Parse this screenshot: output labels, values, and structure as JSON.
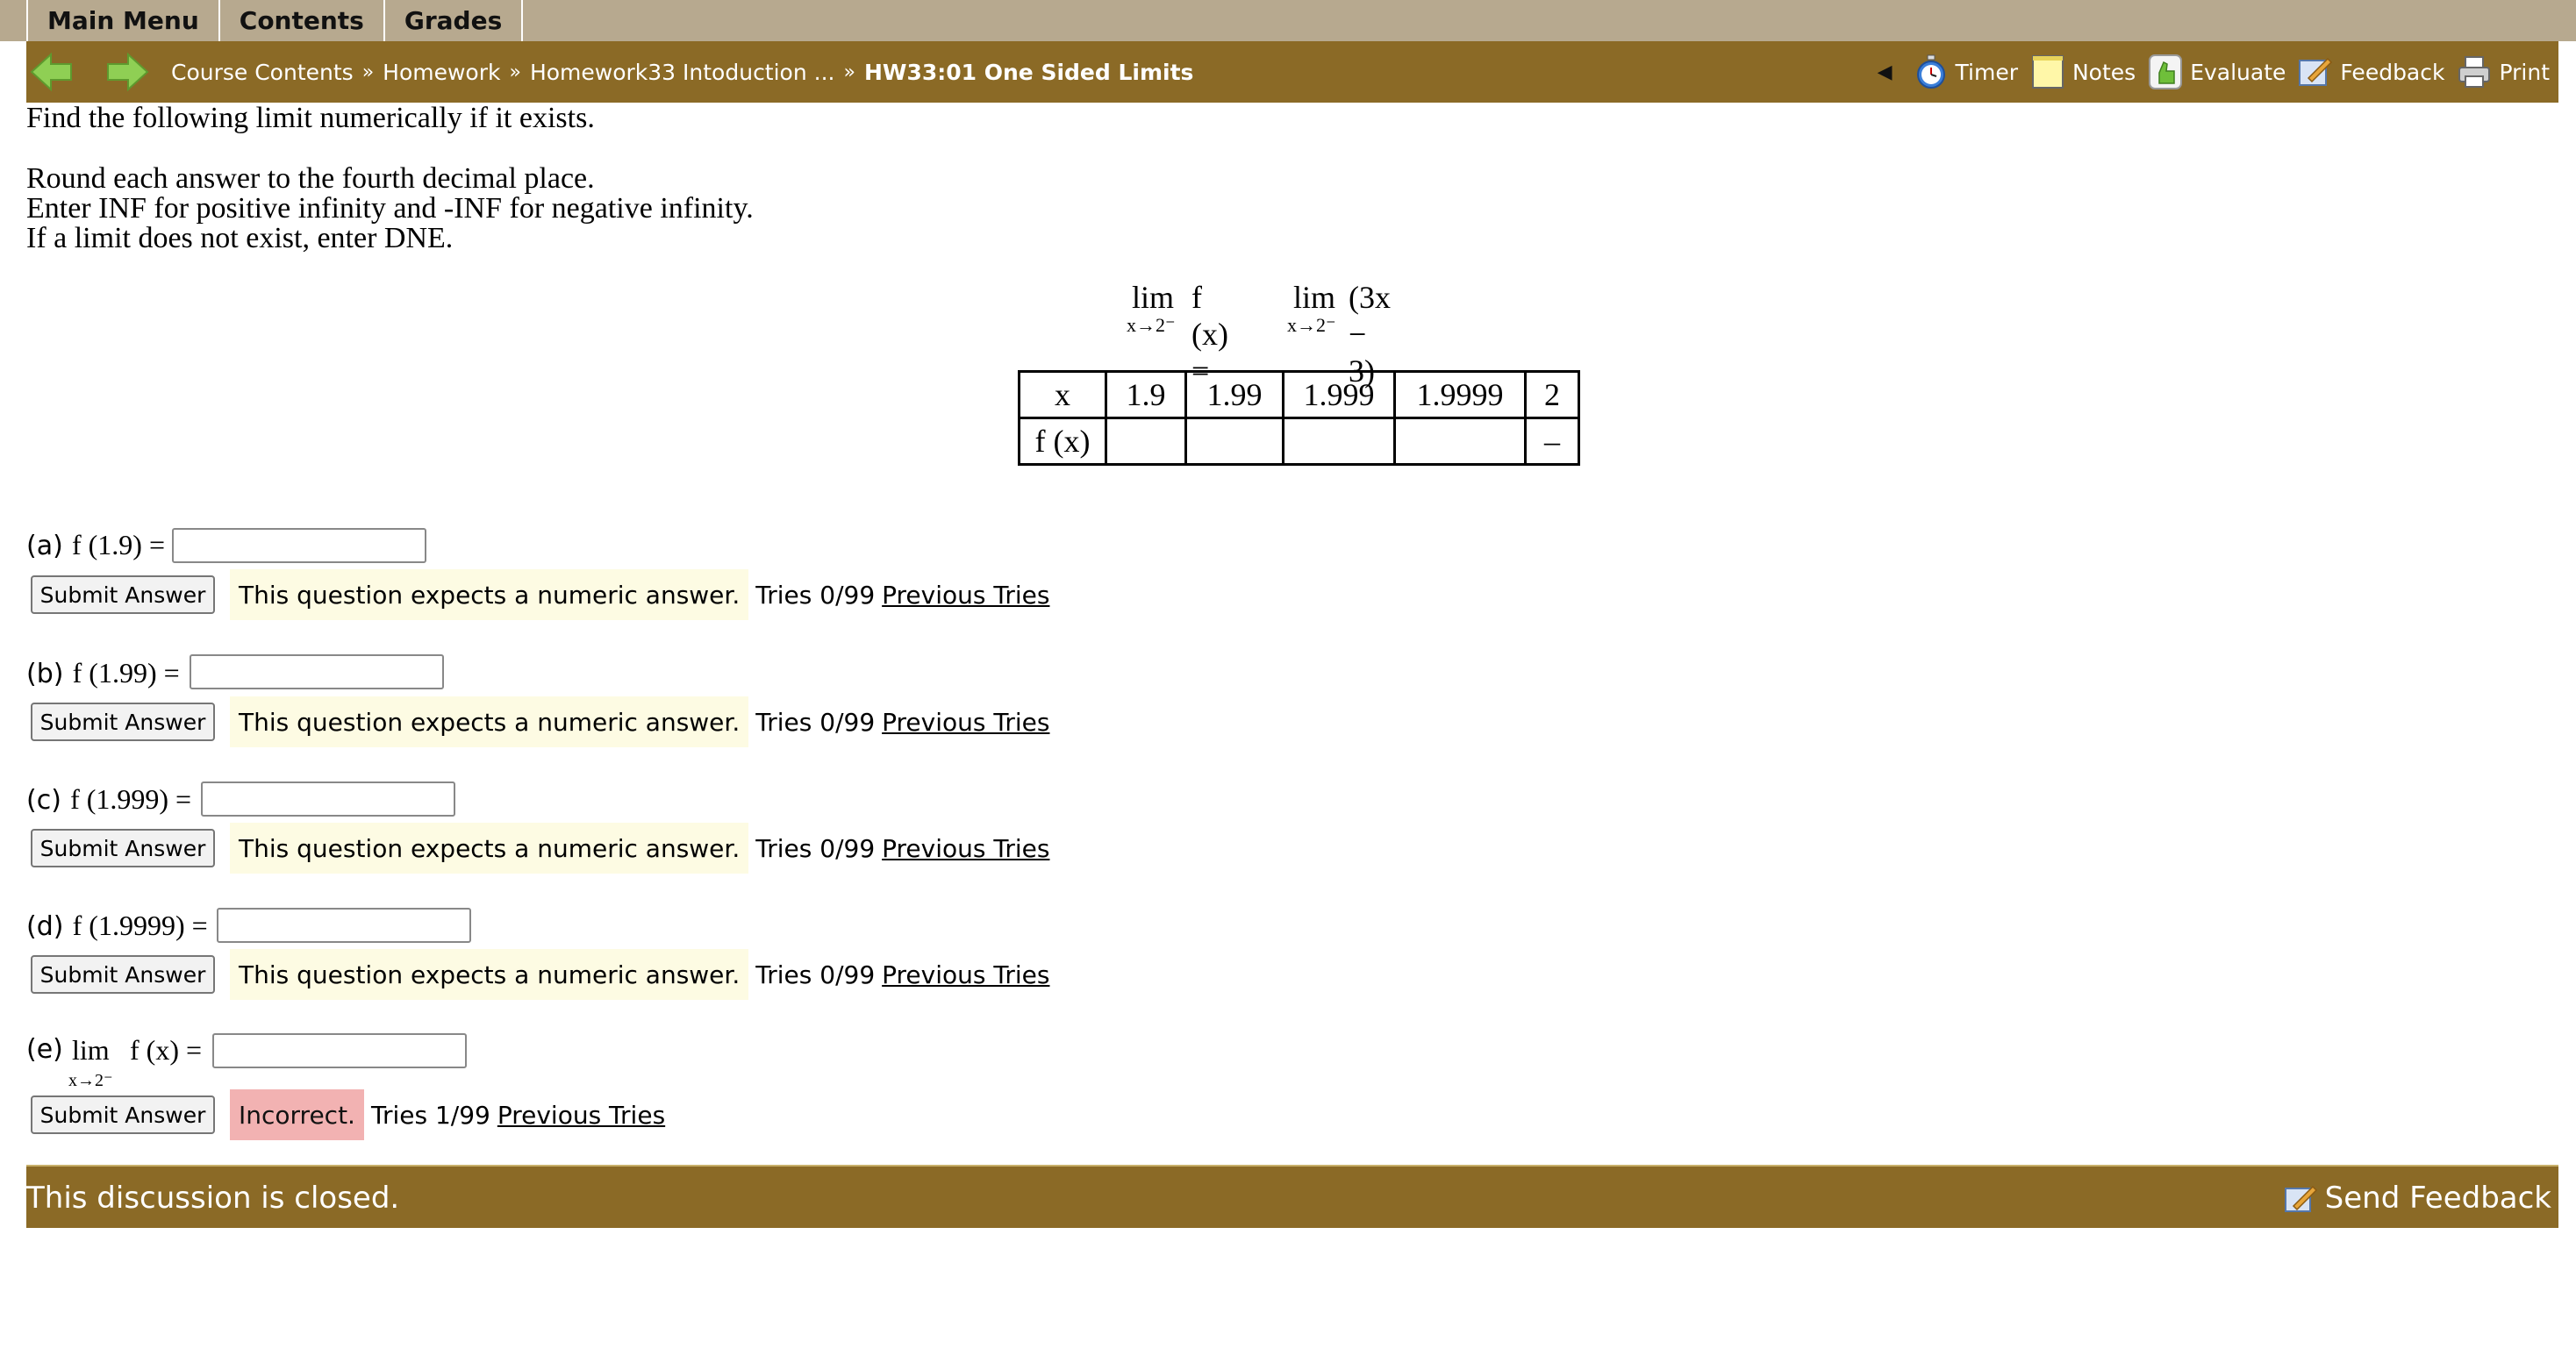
{
  "tabs": [
    "Main Menu",
    "Contents",
    "Grades"
  ],
  "breadcrumbs": {
    "items": [
      "Course Contents",
      "Homework",
      "Homework33 Intoduction ..."
    ],
    "separator": "»",
    "current": "HW33:01 One Sided Limits"
  },
  "tools": {
    "back_marker": "◀",
    "timer": "Timer",
    "notes": "Notes",
    "evaluate": "Evaluate",
    "feedback": "Feedback",
    "print": "Print"
  },
  "problem": {
    "line1": "Find the following limit numerically if it exists.",
    "line2": "Round each answer to the fourth decimal place.",
    "line3": "Enter INF for positive infinity and -INF for negative infinity.",
    "line4": "If a limit does not exist, enter DNE.",
    "equation": {
      "lim": "lim",
      "sub": "x→2⁻",
      "left": "f (x) =",
      "right": "(3x − 3)"
    },
    "table": {
      "row1_header": "x",
      "row2_header": "f (x)",
      "x_values": [
        "1.9",
        "1.99",
        "1.999",
        "1.9999",
        "2"
      ],
      "fx_values": [
        "",
        "",
        "",
        "",
        "–"
      ]
    }
  },
  "questions": [
    {
      "label": "(a)",
      "expr": "f (1.9) =",
      "input_value": "",
      "submit": "Submit Answer",
      "message": "This question expects a numeric answer.",
      "tries": "Tries 0/99",
      "previous": "Previous Tries"
    },
    {
      "label": "(b)",
      "expr": "f (1.99) =",
      "input_value": "",
      "submit": "Submit Answer",
      "message": "This question expects a numeric answer.",
      "tries": "Tries 0/99",
      "previous": "Previous Tries"
    },
    {
      "label": "(c)",
      "expr": "f (1.999) =",
      "input_value": "",
      "submit": "Submit Answer",
      "message": "This question expects a numeric answer.",
      "tries": "Tries 0/99",
      "previous": "Previous Tries"
    },
    {
      "label": "(d)",
      "expr": "f (1.9999) =",
      "input_value": "",
      "submit": "Submit Answer",
      "message": "This question expects a numeric answer.",
      "tries": "Tries 0/99",
      "previous": "Previous Tries"
    },
    {
      "label": "(e)",
      "lim": "lim",
      "sub": "x→2⁻",
      "expr": "f (x) =",
      "input_value": "",
      "submit": "Submit Answer",
      "message": "Incorrect.",
      "tries": "Tries 1/99",
      "previous": "Previous Tries"
    }
  ],
  "footer": {
    "closed": "This discussion is closed.",
    "send_feedback": "Send Feedback"
  },
  "colors": {
    "tabbar": "#b7a98f",
    "navbar": "#8b6a26",
    "notice": "#fdfbe3",
    "incorrect": "#f2b2b2"
  }
}
